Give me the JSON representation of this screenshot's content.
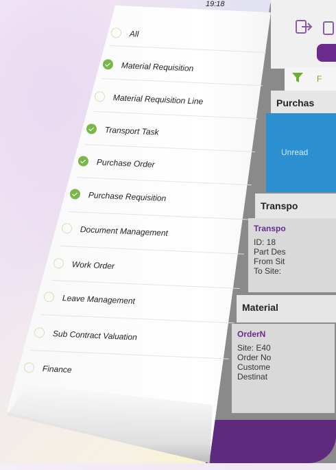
{
  "status_bar": {
    "time": "19:18"
  },
  "background_app": {
    "filter_label": "F",
    "sections": [
      {
        "header": "Purchas",
        "unread_label": "Unread"
      },
      {
        "header": "Transpo",
        "card_title": "Transpo",
        "lines": [
          "ID: 18",
          "Part Des",
          "From Sit",
          "To Site:"
        ]
      },
      {
        "header": "Material",
        "card_title": "OrderN",
        "lines": [
          "Site: E40",
          "Order No",
          "Custome",
          "Destinat"
        ]
      }
    ],
    "colors": {
      "accent_purple": "#6a2b8c",
      "unread_blue": "#2b8fd0",
      "filter_green": "#6cae2f"
    }
  },
  "drawer": {
    "items": [
      {
        "label": "All",
        "checked": false
      },
      {
        "label": "Material Requisition",
        "checked": true
      },
      {
        "label": "Material Requisition Line",
        "checked": false
      },
      {
        "label": "Transport Task",
        "checked": true
      },
      {
        "label": "Purchase Order",
        "checked": true
      },
      {
        "label": "Purchase Requisition",
        "checked": true
      },
      {
        "label": "Document Management",
        "checked": false
      },
      {
        "label": "Work Order",
        "checked": false
      },
      {
        "label": "Leave Management",
        "checked": false
      },
      {
        "label": "Sub Contract Valuation",
        "checked": false
      },
      {
        "label": "Finance",
        "checked": false
      }
    ],
    "colors": {
      "check_on": "#7ab648"
    }
  }
}
